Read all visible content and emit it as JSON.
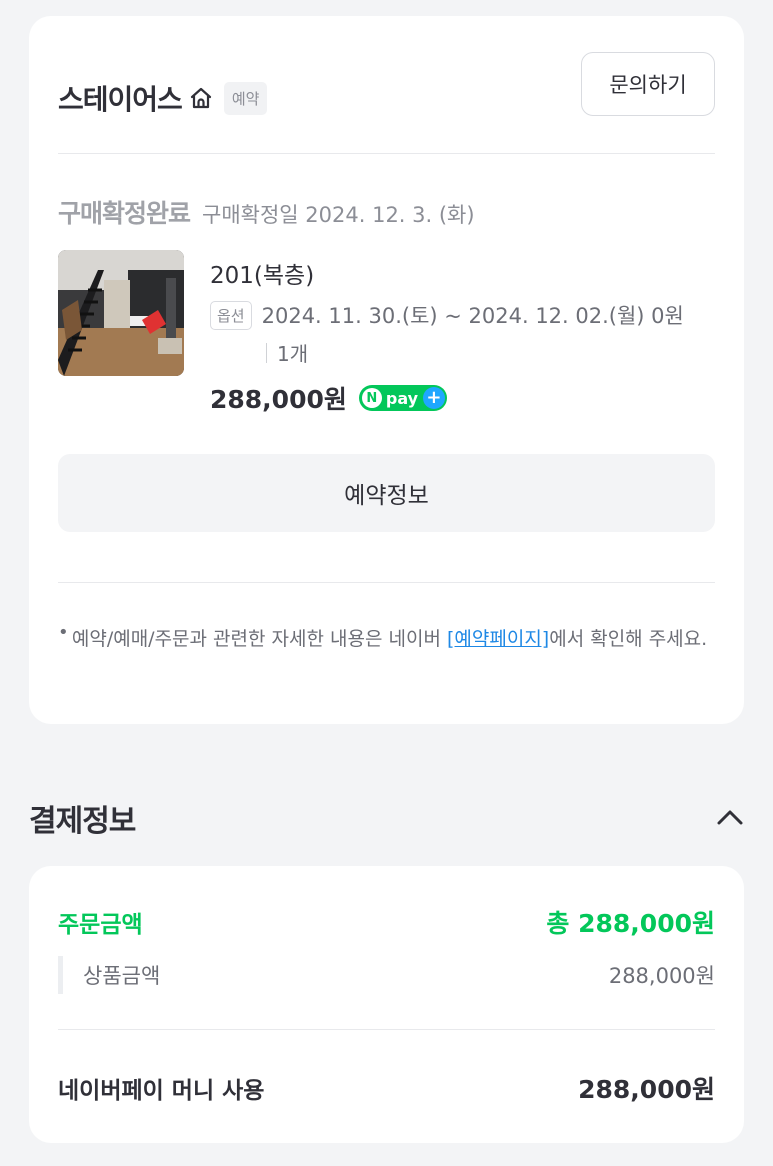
{
  "order_card": {
    "store_name": "스테이어스",
    "store_badge": "예약",
    "inquiry_button": "문의하기",
    "status_label": "구매확정완료",
    "status_date": "구매확정일 2024. 12. 3. (화)",
    "product": {
      "name": "201(복층)",
      "option_tag": "옵션",
      "option_text": "2024. 11. 30.(토) ~ 2024. 12. 02.(월) 0원",
      "quantity": "1개",
      "price": "288,000원",
      "npay_n": "N",
      "npay_label": "pay",
      "npay_plus": "+"
    },
    "reservation_info_button": "예약정보",
    "notice_bullet": "•",
    "notice_before": "예약/예매/주문과 관련한 자세한 내용은 네이버 ",
    "notice_link": "[예약페이지]",
    "notice_after": "에서 확인해 주세요."
  },
  "payment_section": {
    "title": "결제정보",
    "order_amount_label": "주문금액",
    "order_amount_value": "총 288,000원",
    "product_amount_label": "상품금액",
    "product_amount_value": "288,000원",
    "pay_method_label": "네이버페이 머니 사용",
    "pay_method_value": "288,000원"
  },
  "colors": {
    "naver_green": "#03c75a",
    "link_blue": "#1e88e5",
    "page_bg": "#f3f4f6"
  },
  "icons": {
    "home": "home-icon",
    "collapse": "chevron-up-icon"
  }
}
